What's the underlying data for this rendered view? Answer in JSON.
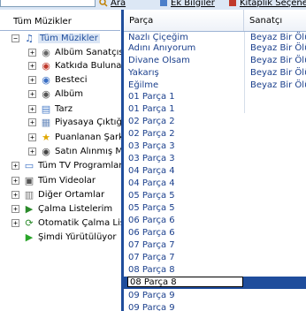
{
  "toolbar": {
    "items": [
      {
        "label": "Ara",
        "icon": "search-icon"
      },
      {
        "label": "Ek Bilgiler",
        "icon": "info-icon"
      },
      {
        "label": "Kitaplık Seçenekleri",
        "icon": "library-options-icon"
      }
    ]
  },
  "left_header": {
    "title": "Tüm Müzikler"
  },
  "columns": [
    "Parça",
    "Sanatçı"
  ],
  "tree": [
    {
      "label": "Tüm Müzikler",
      "icon": "music-note-icon",
      "expander": "−",
      "selected": true
    },
    {
      "label": "Albüm Sanatçısı",
      "icon": "album-artist-icon",
      "expander": "+"
    },
    {
      "label": "Katkıda Bulunan Sanatçı",
      "icon": "contributing-artist-icon",
      "expander": "+"
    },
    {
      "label": "Besteci",
      "icon": "composer-icon",
      "expander": "+"
    },
    {
      "label": "Albüm",
      "icon": "album-icon",
      "expander": "+"
    },
    {
      "label": "Tarz",
      "icon": "genre-icon",
      "expander": "+"
    },
    {
      "label": "Piyasaya Çıktığı Yıl",
      "icon": "release-year-icon",
      "expander": "+"
    },
    {
      "label": "Puanlanan Şarkılar",
      "icon": "rated-songs-icon",
      "expander": "+"
    },
    {
      "label": "Satın Alınmış Müzik",
      "icon": "purchased-music-icon",
      "expander": "+"
    },
    {
      "label": "Tüm TV Programları",
      "icon": "tv-icon",
      "expander": "+"
    },
    {
      "label": "Tüm Videolar",
      "icon": "video-icon",
      "expander": "+"
    },
    {
      "label": "Diğer Ortamlar",
      "icon": "other-media-icon",
      "expander": "+"
    },
    {
      "label": "Çalma Listelerim",
      "icon": "playlist-icon",
      "expander": "+"
    },
    {
      "label": "Otomatik Çalma Listeleri",
      "icon": "auto-playlist-icon",
      "expander": "+"
    },
    {
      "label": "Şimdi Yürütülüyor",
      "icon": "play-icon",
      "expander": ""
    }
  ],
  "tracks": [
    {
      "title": "Nazlı Çiçeğim",
      "artist": "Beyaz Bir Ölüm"
    },
    {
      "title": "Adını Anıyorum",
      "artist": "Beyaz Bir Ölüm"
    },
    {
      "title": "Divane Olsam",
      "artist": "Beyaz Bir Ölüm"
    },
    {
      "title": "Yakarış",
      "artist": "Beyaz Bir Ölüm"
    },
    {
      "title": "Eğilme",
      "artist": "Beyaz Bir Ölüm"
    },
    {
      "title": "01 Parça 1",
      "artist": ""
    },
    {
      "title": "01 Parça 1",
      "artist": ""
    },
    {
      "title": "02 Parça 2",
      "artist": ""
    },
    {
      "title": "02 Parça 2",
      "artist": ""
    },
    {
      "title": "03 Parça 3",
      "artist": ""
    },
    {
      "title": "03 Parça 3",
      "artist": ""
    },
    {
      "title": "04 Parça 4",
      "artist": ""
    },
    {
      "title": "04 Parça 4",
      "artist": ""
    },
    {
      "title": "05 Parça 5",
      "artist": ""
    },
    {
      "title": "05 Parça 5",
      "artist": ""
    },
    {
      "title": "06 Parça 6",
      "artist": ""
    },
    {
      "title": "06 Parça 6",
      "artist": ""
    },
    {
      "title": "07 Parça 7",
      "artist": ""
    },
    {
      "title": "07 Parça 7",
      "artist": ""
    },
    {
      "title": "08 Parça 8",
      "artist": ""
    },
    {
      "title": "08 Parça 8",
      "artist": "",
      "editing": true
    },
    {
      "title": "09 Parça 9",
      "artist": ""
    },
    {
      "title": "09 Parça 9",
      "artist": ""
    }
  ]
}
